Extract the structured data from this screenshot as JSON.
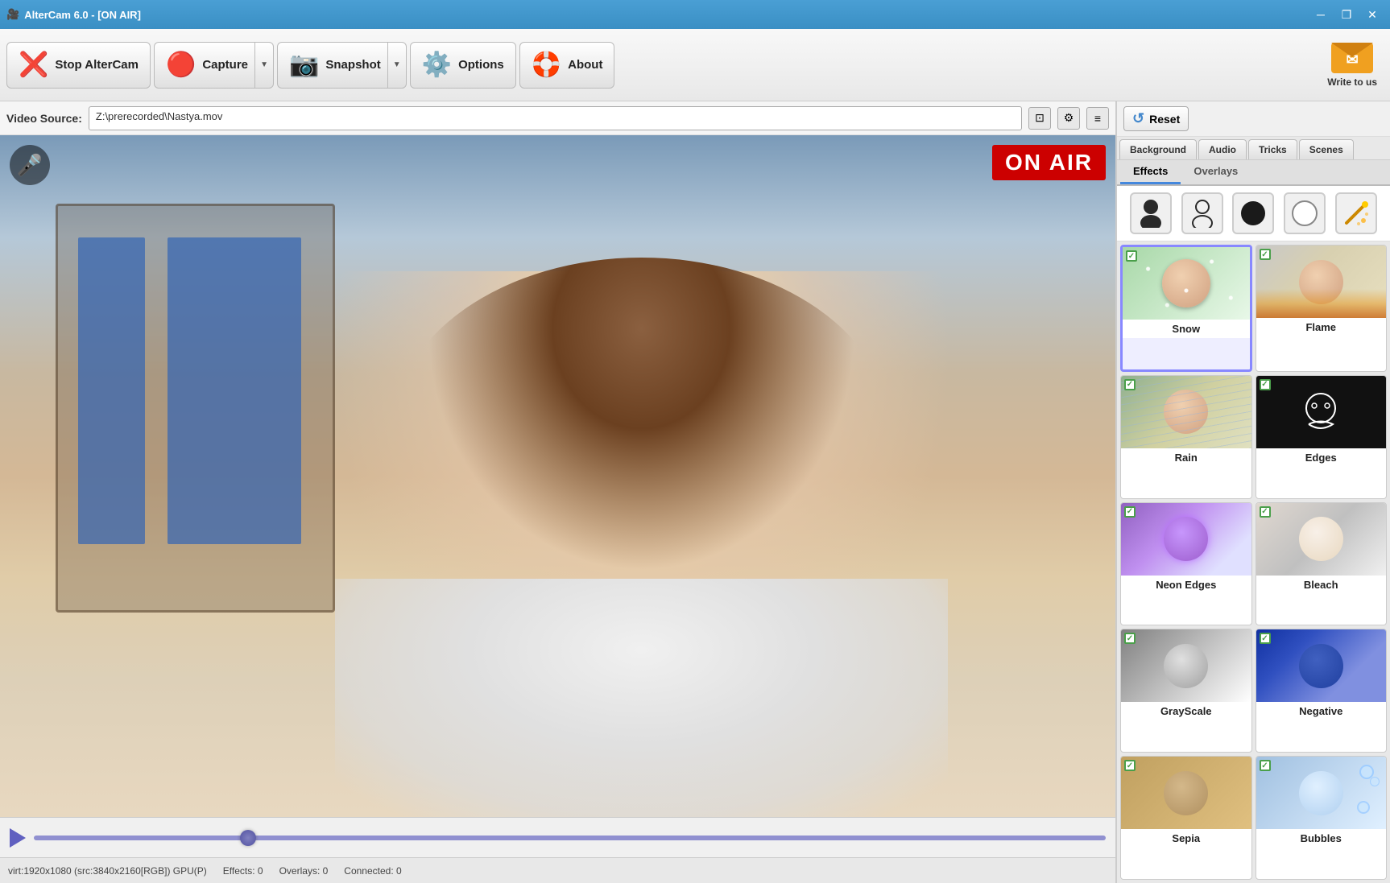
{
  "app": {
    "title": "AlterCam 6.0 - [ON AIR]",
    "icon": "🎥"
  },
  "titlebar": {
    "title": "AlterCam 6.0 - [ON AIR]",
    "minimize_label": "─",
    "restore_label": "❐",
    "close_label": "✕"
  },
  "toolbar": {
    "stop_label": "Stop AlterCam",
    "capture_label": "Capture",
    "snapshot_label": "Snapshot",
    "options_label": "Options",
    "about_label": "About",
    "write_to_us_label": "Write to us"
  },
  "video_source": {
    "label": "Video Source:",
    "path": "Z:\\prerecorded\\Nastya.mov"
  },
  "video": {
    "on_air_label": "ON AIR"
  },
  "status_bar": {
    "resolution": "virt:1920x1080 (src:3840x2160[RGB]) GPU(P)",
    "effects": "Effects: 0",
    "overlays": "Overlays: 0",
    "connected": "Connected: 0"
  },
  "right_panel": {
    "reset_label": "Reset",
    "tabs": [
      {
        "id": "background",
        "label": "Background",
        "active": false
      },
      {
        "id": "audio",
        "label": "Audio",
        "active": false
      },
      {
        "id": "tricks",
        "label": "Tricks",
        "active": false
      },
      {
        "id": "scenes",
        "label": "Scenes",
        "active": false
      }
    ],
    "sub_tabs": [
      {
        "id": "effects",
        "label": "Effects",
        "active": true
      },
      {
        "id": "overlays",
        "label": "Overlays",
        "active": false
      }
    ],
    "effects": [
      {
        "id": "snow",
        "label": "Snow",
        "selected": true,
        "checked": true,
        "thumb_class": "thumb-snow"
      },
      {
        "id": "flame",
        "label": "Flame",
        "selected": false,
        "checked": true,
        "thumb_class": "thumb-flame"
      },
      {
        "id": "rain",
        "label": "Rain",
        "selected": false,
        "checked": true,
        "thumb_class": "thumb-rain"
      },
      {
        "id": "edges",
        "label": "Edges",
        "selected": false,
        "checked": true,
        "thumb_class": "thumb-edges"
      },
      {
        "id": "neon-edges",
        "label": "Neon Edges",
        "selected": false,
        "checked": true,
        "thumb_class": "thumb-neon"
      },
      {
        "id": "bleach",
        "label": "Bleach",
        "selected": false,
        "checked": true,
        "thumb_class": "thumb-bleach"
      },
      {
        "id": "grayscale",
        "label": "GrayScale",
        "selected": false,
        "checked": true,
        "thumb_class": "thumb-grayscale"
      },
      {
        "id": "negative",
        "label": "Negative",
        "selected": false,
        "checked": true,
        "thumb_class": "thumb-negative"
      },
      {
        "id": "sepia",
        "label": "Sepia",
        "selected": false,
        "checked": true,
        "thumb_class": "thumb-sepia"
      },
      {
        "id": "bubbles",
        "label": "Bubbles",
        "selected": false,
        "checked": true,
        "thumb_class": "thumb-bubbles"
      }
    ],
    "icon_filters": [
      {
        "id": "person-dark",
        "symbol": "👤",
        "label": "Person Dark"
      },
      {
        "id": "person-light",
        "symbol": "👤",
        "label": "Person Light"
      },
      {
        "id": "circle-dark",
        "symbol": "⬤",
        "label": "Circle Dark"
      },
      {
        "id": "circle-light",
        "symbol": "○",
        "label": "Circle Light"
      },
      {
        "id": "magic-wand",
        "symbol": "🪄",
        "label": "Magic Wand"
      }
    ]
  }
}
